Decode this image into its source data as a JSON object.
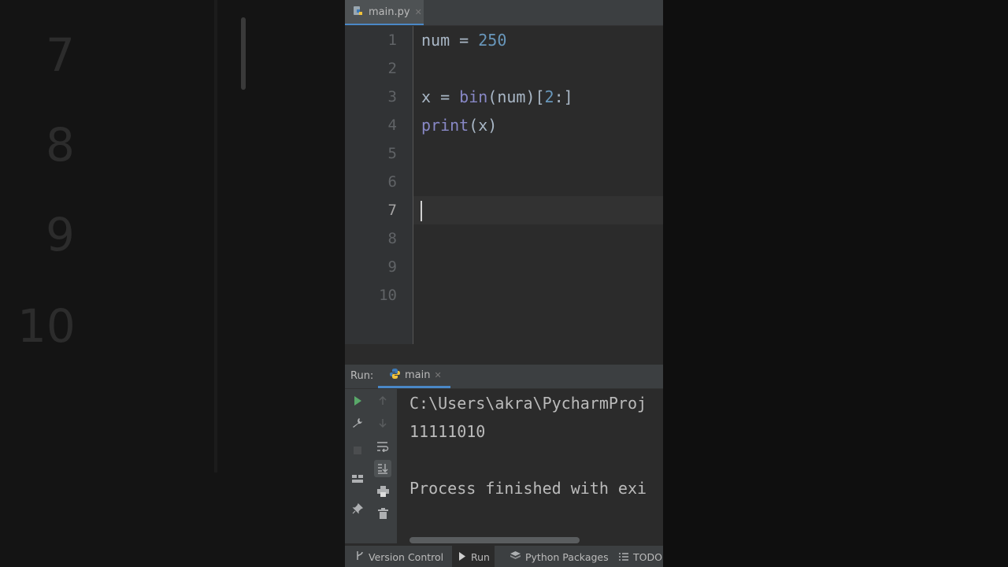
{
  "background": {
    "line_numbers": [
      "7",
      "8",
      "9",
      "10"
    ]
  },
  "editor": {
    "file_tab": {
      "label": "main.py",
      "icon": "python-file-icon"
    },
    "line_numbers": [
      "1",
      "2",
      "3",
      "4",
      "5",
      "6",
      "7",
      "8",
      "9",
      "10"
    ],
    "current_line": "7",
    "lines": [
      {
        "parts": [
          {
            "t": "num = ",
            "c": "plain"
          },
          {
            "t": "250",
            "c": "num"
          }
        ]
      },
      {
        "parts": []
      },
      {
        "parts": [
          {
            "t": "x = ",
            "c": "plain"
          },
          {
            "t": "bin",
            "c": "bi"
          },
          {
            "t": "(num)[",
            "c": "plain"
          },
          {
            "t": "2",
            "c": "num"
          },
          {
            "t": ":]",
            "c": "plain"
          }
        ]
      },
      {
        "parts": [
          {
            "t": "print",
            "c": "bi"
          },
          {
            "t": "(x)",
            "c": "plain"
          }
        ]
      }
    ]
  },
  "run": {
    "title": "Run:",
    "tab_label": "main",
    "tab_icon": "python-icon",
    "toolbar_icons": [
      "run-icon",
      "up-arrow-icon",
      "wrench-icon",
      "down-arrow-icon",
      "soft-wrap-icon",
      "stop-icon",
      "scroll-to-end-icon",
      "layout-icon",
      "print-icon",
      "pin-icon",
      "trash-icon"
    ],
    "console": {
      "path_line": "C:\\Users\\akra\\PycharmProj",
      "output": "11111010",
      "exit_line": "Process finished with exi"
    }
  },
  "statusbar": {
    "items": [
      {
        "label": "Version Control",
        "icon": "branch-icon"
      },
      {
        "label": "Run",
        "icon": "run-triangle-icon"
      },
      {
        "label": "Python Packages",
        "icon": "packages-icon"
      },
      {
        "label": "TODO",
        "icon": "list-icon"
      }
    ]
  },
  "colors": {
    "editor_bg": "#2b2b2b",
    "gutter_bg": "#313335",
    "panel_bg": "#3c3f41",
    "number": "#6897bb",
    "builtin": "#8888c6",
    "text": "#a9b7c6",
    "accent": "#4a88c7",
    "run_green": "#59a869"
  }
}
